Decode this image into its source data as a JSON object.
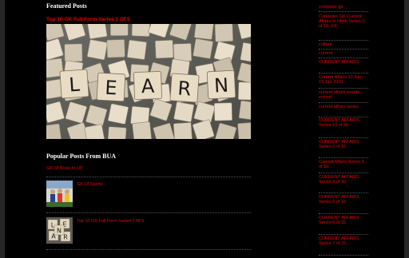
{
  "featured": {
    "title": "Featured Posts",
    "post_title": "Top 10 GK Full Form Series 1 Of 5"
  },
  "popular": {
    "title": "Popular Posts From BUA",
    "first_link": "GK Of Firsts In UP",
    "items": [
      {
        "title": "GK Of Sports"
      },
      {
        "title": "Top 10 GK Full Form Series 1 Of 5"
      }
    ]
  },
  "sidebar": {
    "items": [
      {
        "label": "computer gk"
      },
      {
        "label": "Computer GK Current Affairs In Hindi Series 3 of 10. GK"
      },
      {
        "label": "culture"
      },
      {
        "label": "current"
      },
      {
        "label": "CURRENT AFFAIRS"
      },
      {
        "label": "Current Affairs 10 Jan – 15 Jan 2020"
      },
      {
        "label": "current affairs events solved"
      },
      {
        "label": "current affairs series"
      },
      {
        "label": "CURRENT AFFAIRS Series 10 of 10"
      },
      {
        "label": "CURRENT AFFAIRS Series 2 of 10"
      },
      {
        "label": "Current Affairs Series 3 of 10"
      },
      {
        "label": "CURRENT AFFAIRS Series 4 of 10"
      },
      {
        "label": "CURRENT AFFAIRS Series 5 of 10"
      },
      {
        "label": "CURRENT AFFAIRS Series 6 of 10"
      },
      {
        "label": "CURRENT AFFAIRS Series 7 of 10"
      }
    ]
  },
  "featured_image_letters": [
    "L",
    "E",
    "A",
    "R",
    "N"
  ],
  "thumb_letters": [
    "L",
    "E",
    "A",
    "R",
    "N"
  ],
  "colors": {
    "link": "#e00",
    "background": "#000000",
    "frame": "#262626",
    "text": "#ffffff"
  }
}
